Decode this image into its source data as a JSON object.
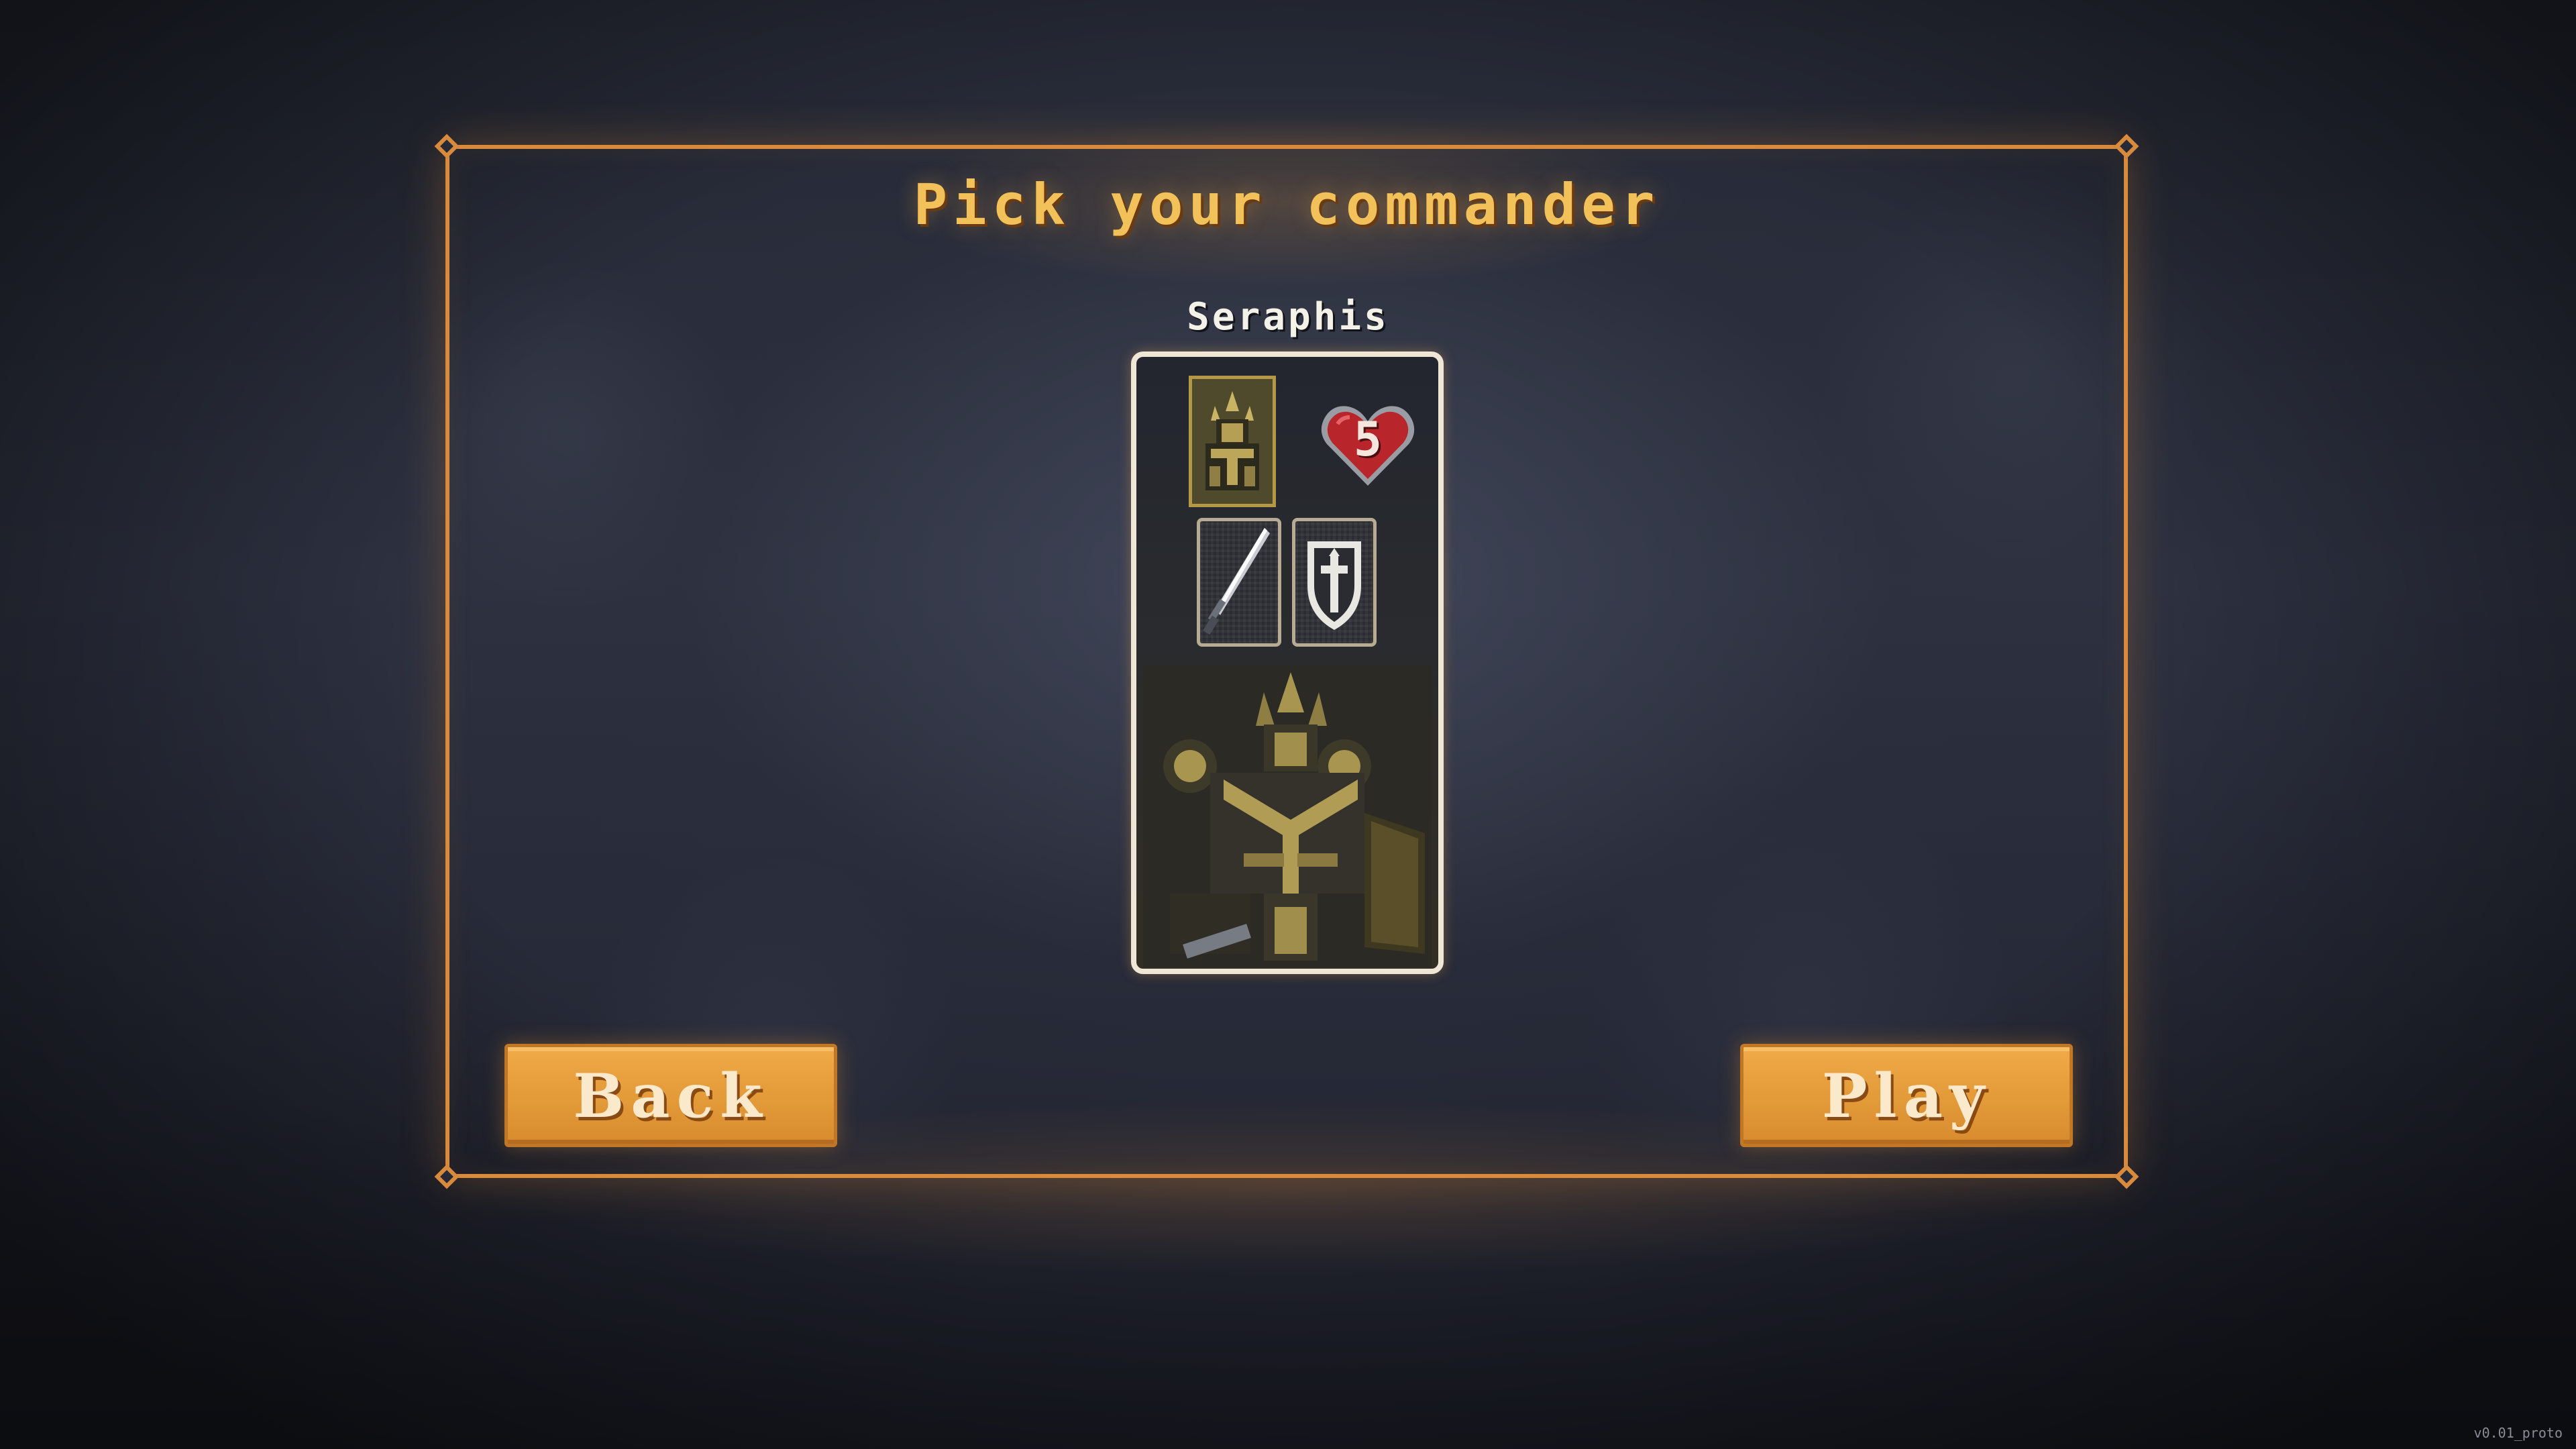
{
  "screen": {
    "title": "Pick your commander"
  },
  "commander": {
    "name": "Seraphis",
    "health": "5",
    "portrait_icon": "armored-knight-portrait",
    "health_icon": "heart-icon",
    "items": [
      {
        "icon": "sword-icon"
      },
      {
        "icon": "shield-cross-icon"
      }
    ]
  },
  "buttons": {
    "back_label": "Back",
    "play_label": "Play"
  },
  "footer": {
    "version": "v0.01_proto"
  },
  "colors": {
    "accent": "#d98b3d",
    "title": "#f3c15a",
    "button": "#e8a040",
    "card_border": "#efe6d6",
    "heart": "#b8262c"
  }
}
